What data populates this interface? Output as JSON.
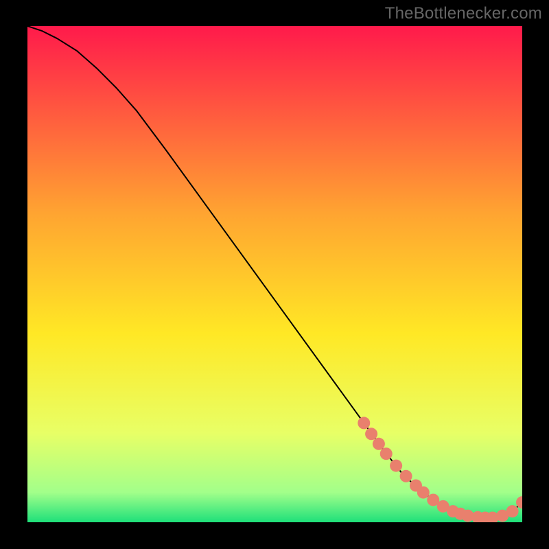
{
  "watermark": "TheBottlenecker.com",
  "chart_data": {
    "type": "line",
    "title": "",
    "xlabel": "",
    "ylabel": "",
    "xlim": [
      0,
      100
    ],
    "ylim": [
      0,
      100
    ],
    "grid": false,
    "gradient_colors": {
      "top": "#ff1a4b",
      "upper_mid": "#ffa531",
      "mid": "#ffe825",
      "lower_mid": "#e8ff66",
      "near_bottom": "#a2ff8a",
      "bottom": "#1ee07a"
    },
    "series": [
      {
        "name": "curve",
        "stroke": "#000000",
        "x": [
          0,
          3,
          6,
          10,
          14,
          18,
          22,
          28,
          36,
          44,
          52,
          60,
          68,
          72,
          76,
          80,
          82,
          84,
          86,
          88,
          90,
          92,
          94,
          96,
          98,
          100
        ],
        "y": [
          100,
          99,
          97.5,
          95,
          91.5,
          87.5,
          83,
          75,
          64,
          53,
          42,
          31,
          20,
          14.5,
          9.5,
          6,
          4.5,
          3.2,
          2.2,
          1.5,
          1.1,
          0.9,
          0.9,
          1.3,
          2.2,
          4.0
        ]
      }
    ],
    "markers": {
      "name": "highlight-dots",
      "fill": "#e9806d",
      "radius_px": 9,
      "x": [
        68,
        69.5,
        71,
        72.5,
        74.5,
        76.5,
        78.5,
        80,
        82,
        84,
        86,
        87.5,
        89,
        91,
        92.5,
        94,
        96,
        98,
        100
      ],
      "y": [
        20,
        17.8,
        15.8,
        13.8,
        11.4,
        9.3,
        7.4,
        6.0,
        4.5,
        3.2,
        2.2,
        1.7,
        1.3,
        1.0,
        0.9,
        0.9,
        1.3,
        2.2,
        4.0
      ]
    }
  }
}
